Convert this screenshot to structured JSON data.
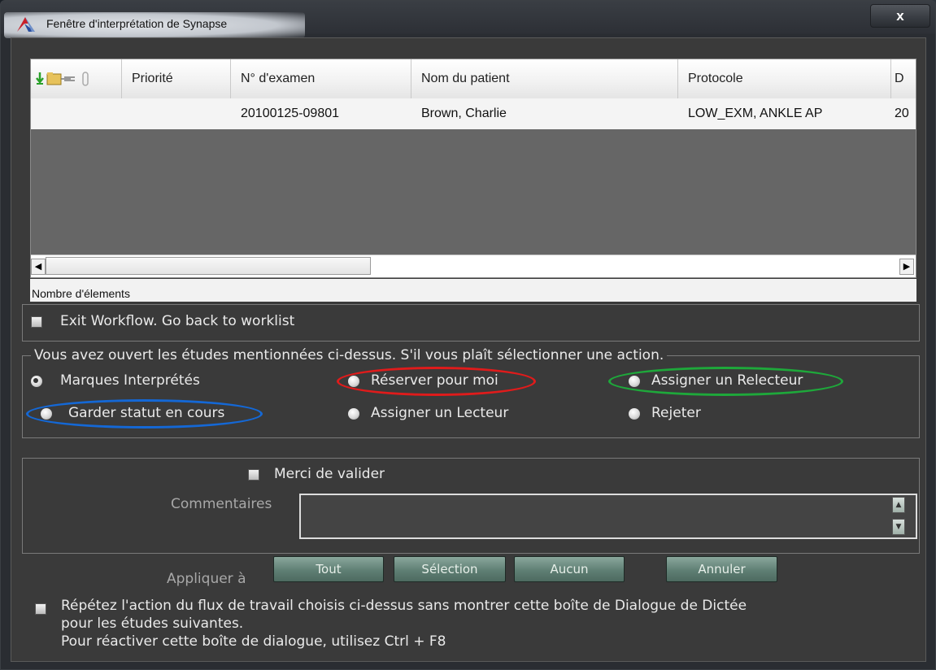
{
  "window": {
    "title": "Fenêtre d'interprétation de Synapse",
    "close_label": "x"
  },
  "table": {
    "columns": [
      "Priorité",
      "N° d'examen",
      "Nom du patient",
      "Protocole",
      "D"
    ],
    "rows": [
      {
        "priority": "",
        "exam_no": "20100125-09801",
        "patient": "Brown, Charlie",
        "protocol": "LOW_EXM, ANKLE AP",
        "date": "20"
      }
    ],
    "scroll_left": "◀",
    "scroll_right": "▶"
  },
  "count_label": "Nombre d'élements",
  "exit_workflow_label": "Exit Workflow. Go back to worklist",
  "actions": {
    "legend": "Vous avez ouvert les études mentionnées ci-dessus. S'il vous plaît sélectionner une action.",
    "options": [
      {
        "label": "Marques Interprétés",
        "selected": true
      },
      {
        "label": "Réserver pour moi",
        "selected": false
      },
      {
        "label": "Assigner un Relecteur",
        "selected": false
      },
      {
        "label": "Garder statut en cours",
        "selected": false
      },
      {
        "label": "Assigner un Lecteur",
        "selected": false
      },
      {
        "label": "Rejeter",
        "selected": false
      }
    ],
    "highlight_colors": {
      "red": "#e01b1b",
      "green": "#1ea83a",
      "blue": "#1468d6"
    }
  },
  "comments": {
    "validate_label": "Merci de valider",
    "comment_label": "Commentaires"
  },
  "apply": {
    "label": "Appliquer à",
    "buttons": [
      "Tout",
      "Sélection",
      "Aucun",
      "Annuler"
    ]
  },
  "repeat_notice": {
    "line1": "Répétez l'action du flux de travail choisis ci-dessus sans montrer cette boîte de Dialogue de Dictée",
    "line2": "pour les études suivantes.",
    "line3": "Pour réactiver cette boîte de dialogue, utilisez Ctrl + F8"
  }
}
